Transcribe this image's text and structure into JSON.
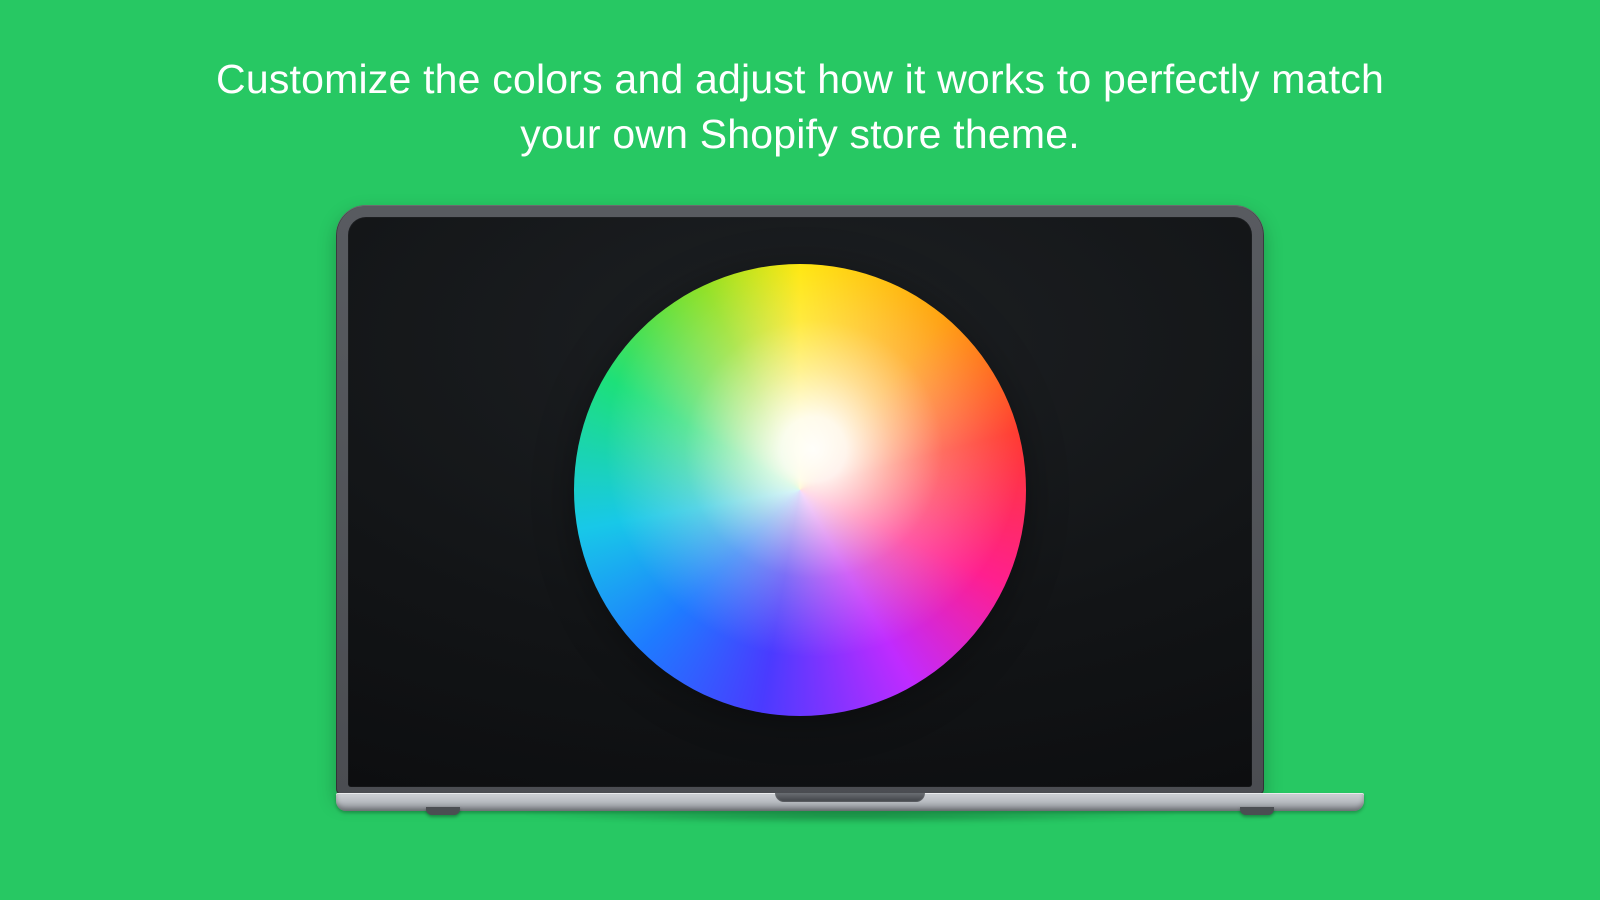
{
  "hero": {
    "headline": "Customize the colors and adjust how it works to perfectly match your own Shopify store theme."
  },
  "colors": {
    "background": "#27c863",
    "headline_text": "#ffffff"
  },
  "illustration": {
    "device": "laptop",
    "content": "color-wheel"
  }
}
